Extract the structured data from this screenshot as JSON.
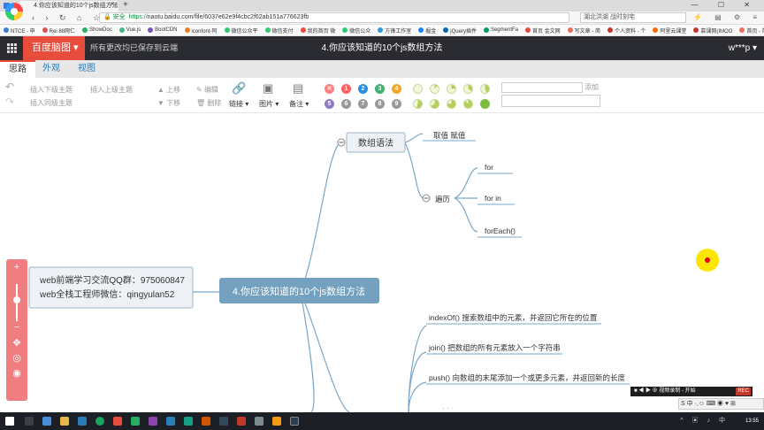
{
  "browser": {
    "tab_title": "4.你应该知道的10个js数组方法",
    "tab_close": "×",
    "new_tab": "+",
    "window_controls": "— ☐ ✕",
    "nav": "‹ › ↻ ⌂ ☆",
    "secure_label": "🔒 安全",
    "url_scheme": "https://",
    "url_rest": "naotu.baidu.com/file/6037e62e9f4cbc2f62ab151a776623fb",
    "search_placeholder": "湖北洪湖 战时刻宅",
    "addr_icons": "⚡ ▤ ⚙ ≡"
  },
  "bookmarks": [
    {
      "label": "NTCE - 申",
      "color": "#3a7bd5"
    },
    {
      "label": "Rei 88网仁",
      "color": "#d9534f"
    },
    {
      "label": "ShowDoc",
      "color": "#27ae60"
    },
    {
      "label": "Vue.js",
      "color": "#42b883"
    },
    {
      "label": "BootCDN",
      "color": "#7952b3"
    },
    {
      "label": "iconfont-阿",
      "color": "#e67e22"
    },
    {
      "label": "微信公众平",
      "color": "#2ecc71"
    },
    {
      "label": "微信支付",
      "color": "#2ecc71"
    },
    {
      "label": "我的首页 微",
      "color": "#e74c3c"
    },
    {
      "label": "微信公众",
      "color": "#2ecc71"
    },
    {
      "label": "方锋工作室",
      "color": "#3498db"
    },
    {
      "label": "掘金",
      "color": "#1e80ff"
    },
    {
      "label": "jQuery插件",
      "color": "#0769ad"
    },
    {
      "label": "SegmentFa",
      "color": "#009a61"
    },
    {
      "label": "首页 金文网",
      "color": "#e74c3c"
    },
    {
      "label": "写文章 - 简",
      "color": "#ea6f5a"
    },
    {
      "label": "个人资料 - 个",
      "color": "#c0392b"
    },
    {
      "label": "阿里云课堂",
      "color": "#ff6a00"
    },
    {
      "label": "慕课网(IMOO",
      "color": "#c0392b"
    },
    {
      "label": "首页 - 简书",
      "color": "#ea6f5a"
    }
  ],
  "app": {
    "brand": "百度脑图 ▾",
    "saved_status": "所有更改均已保存到云端",
    "doc_title": "4.你应该知道的10个js数组方法",
    "user": "w***p ▾"
  },
  "menu_tabs": [
    {
      "label": "思路",
      "active": true
    },
    {
      "label": "外观",
      "active": false
    },
    {
      "label": "视图",
      "active": false
    }
  ],
  "toolbar": {
    "undo": "↶",
    "redo": "↷",
    "insert_child": "插入下级主题",
    "insert_parent": "插入上级主题",
    "insert_sibling": "插入同级主题",
    "move_up": "上移",
    "move_down": "下移",
    "edit": "编辑",
    "delete": "删除",
    "link": "链接 ▾",
    "image": "图片 ▾",
    "note": "备注 ▾",
    "add": "添加",
    "priorities": [
      {
        "label": "✕",
        "color": "#ff8080"
      },
      {
        "label": "1",
        "color": "#ff6060"
      },
      {
        "label": "2",
        "color": "#2a8ee0"
      },
      {
        "label": "3",
        "color": "#3cb371"
      },
      {
        "label": "4",
        "color": "#f5a623"
      },
      {
        "label": "5",
        "color": "#8e7cc3"
      },
      {
        "label": "6",
        "color": "#999999"
      },
      {
        "label": "7",
        "color": "#999999"
      },
      {
        "label": "8",
        "color": "#999999"
      },
      {
        "label": "9",
        "color": "#999999"
      }
    ]
  },
  "mindmap": {
    "root": "4.你应该知道的10个js数组方法",
    "note_line1": "web前端学习交流QQ群：975060847",
    "note_line2": "web全栈工程师微信：qingyulan52",
    "branch_syntax": "数组语法",
    "get_set": "取值 赋值",
    "traverse": "遍历",
    "loop_for": "for",
    "loop_for_in": "for  in",
    "loop_foreach": "forEach()",
    "index_of": "indexOf()  搜索数组中的元素，并返回它所在的位置",
    "join": "join() 把数组的所有元素放入一个字符串",
    "push": "push()  向数组的末尾添加一个或更多元素，并返回新的长度",
    "next_partial": "·  ·  ·"
  },
  "zoom": {
    "zoom_in": "+",
    "zoom_out": "−",
    "move": "✥",
    "locate": "◎",
    "eye": "◉"
  },
  "recorder": {
    "label": "视频录制 - 开始",
    "badge": "REC"
  },
  "ime": "S 中 ·,☺ ⌨ ◉ ♥ ⊞",
  "taskbar": {
    "tray": "^ ▣ ♪ 中",
    "clock": "13:55"
  },
  "colors": {
    "header_bg": "#2a2c32",
    "brand_red": "#e74c3c",
    "root_node": "#73a1bf",
    "link_blue": "#2b7bb9",
    "zoom_panel": "#f07d7f"
  }
}
